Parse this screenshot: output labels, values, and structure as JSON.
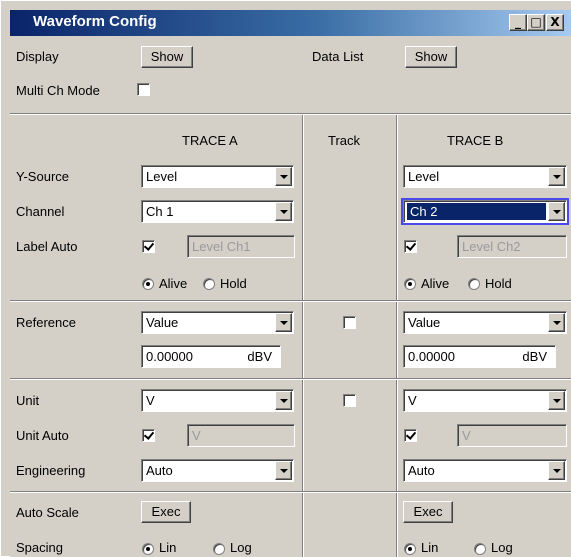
{
  "window": {
    "title": "Waveform Config"
  },
  "titlebar_buttons": {
    "minimize": "_",
    "restore": "□",
    "close": "X"
  },
  "top": {
    "display_label": "Display",
    "display_button": "Show",
    "datalist_label": "Data List",
    "datalist_button": "Show",
    "multich_label": "Multi Ch Mode",
    "multich_checked": false
  },
  "columns": {
    "trace_a": "TRACE A",
    "track": "Track",
    "trace_b": "TRACE B"
  },
  "rows": {
    "ysource_label": "Y-Source",
    "channel_label": "Channel",
    "labelauto_label": "Label Auto",
    "reference_label": "Reference",
    "unit_label": "Unit",
    "unitauto_label": "Unit Auto",
    "engineering_label": "Engineering",
    "autoscale_label": "Auto Scale",
    "spacing_label": "Spacing"
  },
  "trace_a": {
    "ysource": "Level",
    "channel": "Ch 1",
    "label_auto_checked": true,
    "label_value": "Level Ch1",
    "alive_label": "Alive",
    "hold_label": "Hold",
    "mode": "Alive",
    "reference": "Value",
    "ref_value": "0.00000",
    "ref_unit": "dBV",
    "unit": "V",
    "unit_auto_checked": true,
    "unit_auto_value": "V",
    "engineering": "Auto",
    "autoscale_button": "Exec",
    "lin_label": "Lin",
    "log_label": "Log",
    "spacing": "Lin"
  },
  "track": {
    "reference_checked": false,
    "unit_checked": false
  },
  "trace_b": {
    "ysource": "Level",
    "channel": "Ch 2",
    "label_auto_checked": true,
    "label_value": "Level Ch2",
    "alive_label": "Alive",
    "hold_label": "Hold",
    "mode": "Alive",
    "reference": "Value",
    "ref_value": "0.00000",
    "ref_unit": "dBV",
    "unit": "V",
    "unit_auto_checked": true,
    "unit_auto_value": "V",
    "engineering": "Auto",
    "autoscale_button": "Exec",
    "lin_label": "Lin",
    "log_label": "Log",
    "spacing": "Lin"
  }
}
